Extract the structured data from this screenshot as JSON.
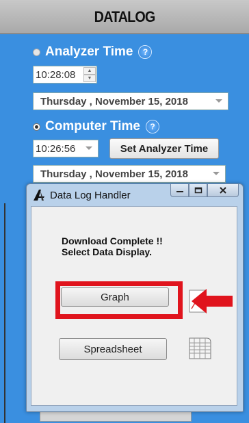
{
  "panel": {
    "title": "DATALOG",
    "analyzer_time": {
      "label": "Analyzer Time",
      "help": "?",
      "time": "10:28:08",
      "date": "Thursday   ,   November  15, 2018"
    },
    "computer_time": {
      "label": "Computer Time",
      "help": "?",
      "time": "10:26:56",
      "date": "Thursday   ,   November  15, 2018",
      "set_button": "Set Analyzer Time"
    }
  },
  "dialog": {
    "title": "Data Log Handler",
    "message_line1": "Download Complete !!",
    "message_line2": "Select Data Display.",
    "graph_button": "Graph",
    "spreadsheet_button": "Spreadsheet"
  },
  "colors": {
    "panel_bg": "#3a8fe0",
    "highlight": "#e0141d"
  }
}
